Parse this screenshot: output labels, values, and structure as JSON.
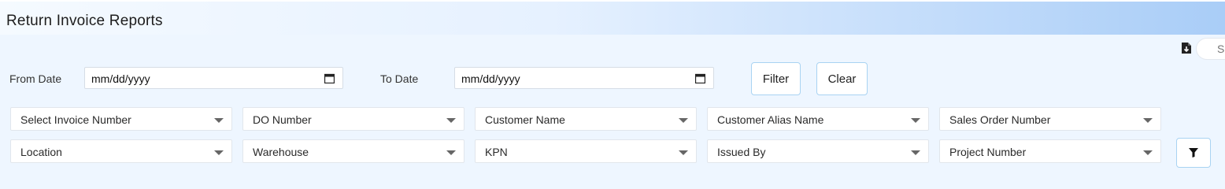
{
  "header": {
    "title": "Return Invoice Reports"
  },
  "toolbar": {
    "export_icon": "file-export-icon",
    "search_placeholder": "Search"
  },
  "date_filter": {
    "from_label": "From Date",
    "from_value": "mm/dd/yyyy",
    "to_label": "To Date",
    "to_value": "mm/dd/yyyy",
    "filter_label": "Filter",
    "clear_label": "Clear"
  },
  "filters": {
    "row1": [
      "Select Invoice Number",
      "DO Number",
      "Customer Name",
      "Customer Alias Name",
      "Sales Order Number"
    ],
    "row2": [
      "Location",
      "Warehouse",
      "KPN",
      "Issued By",
      "Project Number"
    ],
    "funnel_icon": "funnel-icon"
  }
}
